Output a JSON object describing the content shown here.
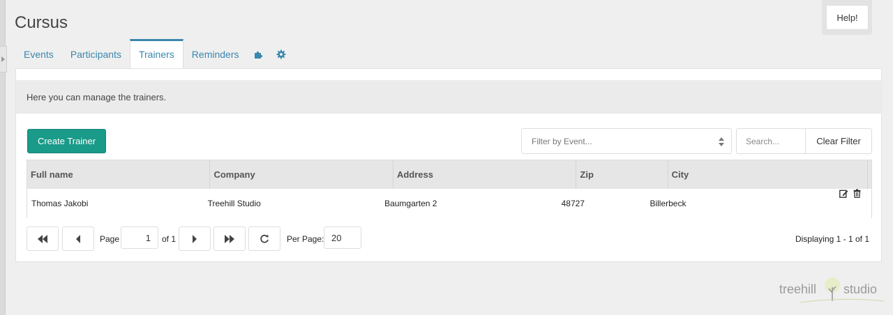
{
  "app": {
    "title": "Cursus",
    "help_label": "Help!"
  },
  "tabs": [
    {
      "label": "Events"
    },
    {
      "label": "Participants"
    },
    {
      "label": "Trainers"
    },
    {
      "label": "Reminders"
    },
    {
      "icon": "puzzle-icon"
    },
    {
      "icon": "gear-icon"
    }
  ],
  "active_tab": "Trainers",
  "info": {
    "text": "Here you can manage the trainers."
  },
  "toolbar": {
    "create_label": "Create Trainer",
    "filter_placeholder": "Filter by Event...",
    "search_placeholder": "Search...",
    "clear_label": "Clear Filter"
  },
  "table": {
    "columns": [
      "Full name",
      "Company",
      "Address",
      "Zip",
      "City"
    ],
    "rows": [
      {
        "full_name": "Thomas Jakobi",
        "company": "Treehill Studio",
        "address": "Baumgarten 2",
        "zip": "48727",
        "city": "Billerbeck"
      }
    ]
  },
  "pager": {
    "page_label": "Page",
    "page_value": "1",
    "of_label": "of 1",
    "per_page_label": "Per Page:",
    "per_page_value": "20",
    "displaying": "Displaying 1 - 1 of 1"
  },
  "footer": {
    "logo_left": "treehill",
    "logo_right": "studio"
  },
  "colors": {
    "accent": "#3a87ad",
    "primary_button": "#1a9a89"
  }
}
